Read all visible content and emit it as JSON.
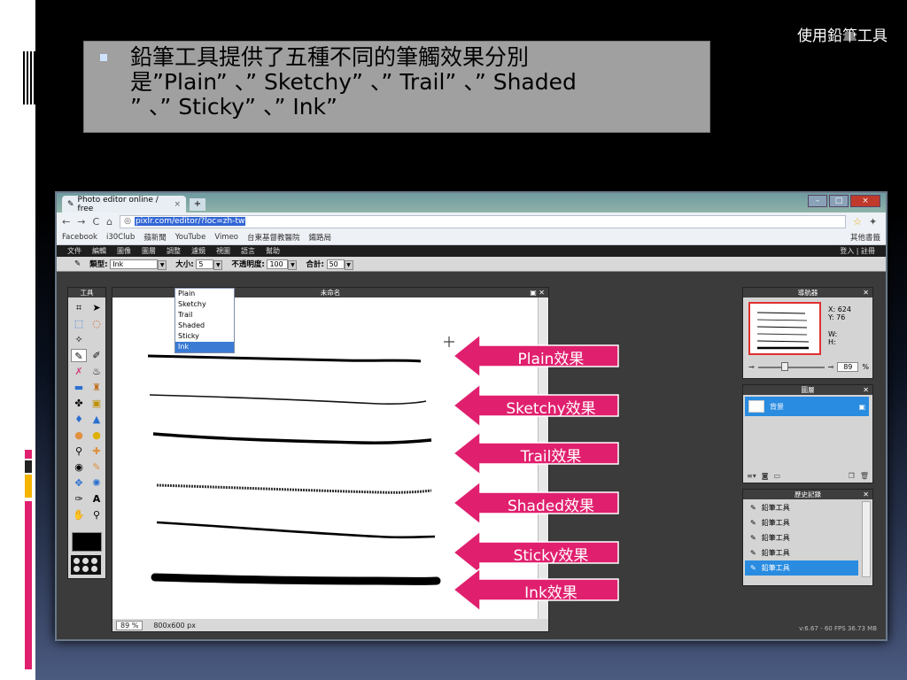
{
  "slide": {
    "title": "使用鉛筆工具",
    "bullet_line1": "鉛筆工具提供了五種不同的筆觸效果分別",
    "bullet_line2": "是”Plain” 、” Sketchy” 、” Trail” 、” Shaded",
    "bullet_line3": "” 、” Sticky” 、” Ink”"
  },
  "browser": {
    "tab_title": "Photo editor online / free",
    "url_selected": "pixlr.com/editor/?loc=zh-tw",
    "bookmarks": [
      "Facebook",
      "i30Club",
      "蘋新聞",
      "YouTube",
      "Vimeo",
      "台東基督教醫院",
      "鐵路局"
    ],
    "other_bookmarks": "其他書籤"
  },
  "app": {
    "menu": [
      "文件",
      "編輯",
      "圖像",
      "圖層",
      "調整",
      "濾鏡",
      "視圖",
      "語言",
      "幫助"
    ],
    "login": "登入 | 註冊",
    "options": {
      "type_label": "類型:",
      "type_value": "Ink",
      "size_label": "大小:",
      "size_value": "5",
      "opacity_label": "不透明度:",
      "opacity_value": "100",
      "total_label": "合計:",
      "total_value": "50"
    },
    "dropdown_options": [
      "Plain",
      "Sketchy",
      "Trail",
      "Shaded",
      "Sticky",
      "Ink"
    ],
    "tools_title": "工具",
    "canvas_title": "未命名",
    "status_zoom": "89",
    "status_percent": "%",
    "status_size": "800x600 px",
    "navigator": {
      "title": "導航器",
      "x": "X: 624",
      "y": "Y: 76",
      "w": "W:",
      "h": "H:",
      "zoom": "89",
      "percent": "%"
    },
    "layers": {
      "title": "圖層",
      "background": "背景"
    },
    "history": {
      "title": "歷史記錄",
      "items": [
        "鉛筆工具",
        "鉛筆工具",
        "鉛筆工具",
        "鉛筆工具",
        "鉛筆工具"
      ]
    },
    "fps": "v:6.67 - 60 FPS 36.73 MB"
  },
  "labels": [
    "Plain效果",
    "Sketchy效果",
    "Trail效果",
    "Shaded效果",
    "Sticky效果",
    "Ink效果"
  ],
  "colors": {
    "arrow": "#e0206e",
    "highlight": "#2a8ce0"
  }
}
